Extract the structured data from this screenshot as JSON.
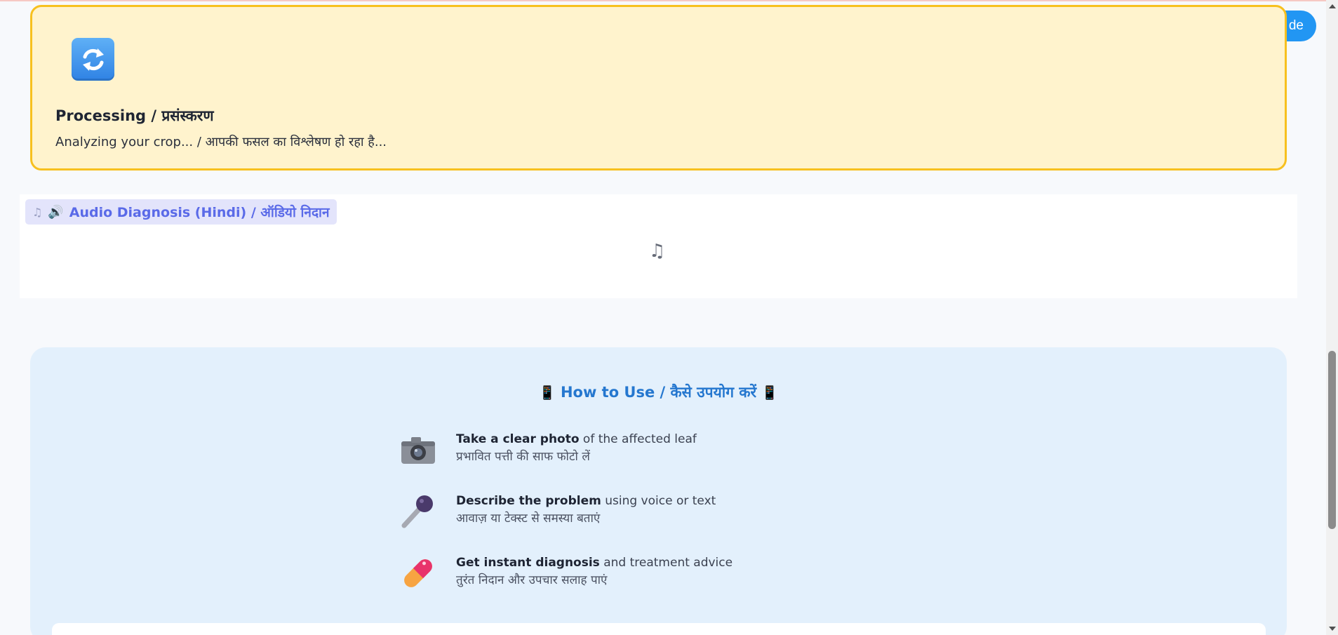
{
  "floating_button": {
    "label": "de"
  },
  "processing": {
    "icon": "sync-icon",
    "title": "Processing / प्रसंस्करण",
    "message": "Analyzing your crop... / आपकी फसल का विश्लेषण हो रहा है..."
  },
  "audio": {
    "tag_note_icon": "♫",
    "tag_speaker_icon": "🔊",
    "title": "Audio Diagnosis (Hindi) / ऑडियो निदान",
    "player_icon": "♫"
  },
  "how_to_use": {
    "title": "How to Use / कैसे उपयोग करें",
    "title_icon": "📱",
    "steps": [
      {
        "icon": "camera-icon",
        "bold": "Take a clear photo",
        "rest": " of the affected leaf",
        "hindi": "प्रभावित पत्ती की साफ फोटो लें"
      },
      {
        "icon": "microphone-icon",
        "bold": "Describe the problem",
        "rest": " using voice or text",
        "hindi": "आवाज़ या टेक्स्ट से समस्या बताएं"
      },
      {
        "icon": "pill-icon",
        "bold": "Get instant diagnosis",
        "rest": " and treatment advice",
        "hindi": "तुरंत निदान और उपचार सलाह पाएं"
      }
    ]
  },
  "colors": {
    "processing_bg": "#fff3cd",
    "processing_border": "#f7c01f",
    "accent_blue": "#2577cf",
    "audio_tag_text": "#5a6ae8"
  }
}
